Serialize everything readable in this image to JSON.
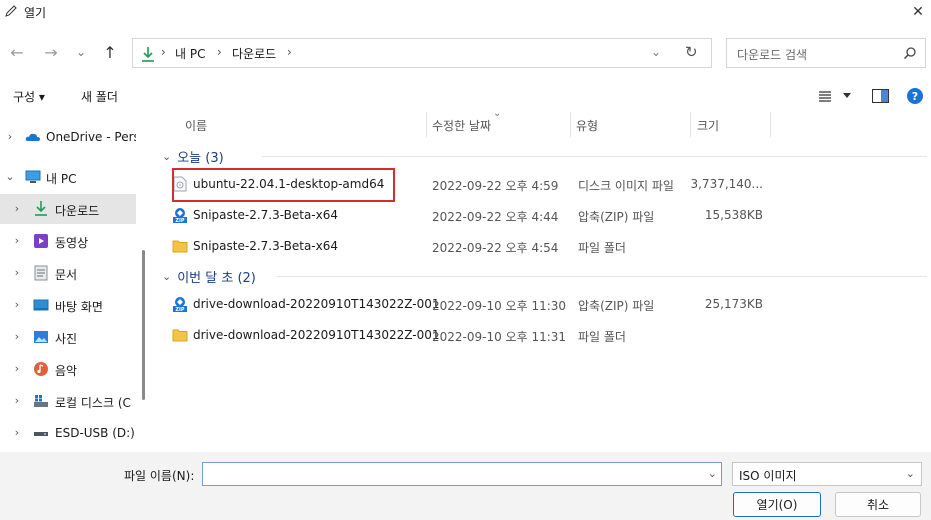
{
  "window": {
    "title": "열기",
    "close_glyph": "✕"
  },
  "nav": {
    "back_glyph": "←",
    "forward_glyph": "→",
    "recent_glyph": "⌄",
    "up_glyph": "↑",
    "refresh_glyph": "↻",
    "dropdown_glyph": "⌄"
  },
  "address": {
    "separator": "›",
    "crumbs": [
      "내 PC",
      "다운로드"
    ]
  },
  "search": {
    "placeholder": "다운로드 검색"
  },
  "toolbar": {
    "organize_label": "구성 ▾",
    "new_folder_label": "새 폴더"
  },
  "sidebar": {
    "items": [
      {
        "label": "OneDrive - Perso",
        "icon": "onedrive-cloud-icon",
        "expand": "›"
      },
      {
        "label": "내 PC",
        "icon": "pc-monitor-icon",
        "expand": "⌄"
      },
      {
        "label": "다운로드",
        "icon": "download-arrow-icon",
        "expand": "›"
      },
      {
        "label": "동영상",
        "icon": "video-icon",
        "expand": "›"
      },
      {
        "label": "문서",
        "icon": "document-icon",
        "expand": "›"
      },
      {
        "label": "바탕 화면",
        "icon": "desktop-icon",
        "expand": "›"
      },
      {
        "label": "사진",
        "icon": "pictures-icon",
        "expand": "›"
      },
      {
        "label": "음악",
        "icon": "music-icon",
        "expand": "›"
      },
      {
        "label": "로컬 디스크 (C",
        "icon": "local-disk-icon",
        "expand": "›"
      },
      {
        "label": "ESD-USB (D:)",
        "icon": "usb-drive-icon",
        "expand": "›"
      }
    ]
  },
  "columns": [
    "이름",
    "수정한 날짜",
    "유형",
    "크기"
  ],
  "groups": [
    {
      "title": "오늘 (3)",
      "files": [
        {
          "name": "ubuntu-22.04.1-desktop-amd64",
          "date": "2022-09-22 오후 4:59",
          "type": "디스크 이미지 파일",
          "size": "3,737,140...",
          "icon": "disc-image-file-icon"
        },
        {
          "name": "Snipaste-2.7.3-Beta-x64",
          "date": "2022-09-22 오후 4:44",
          "type": "압축(ZIP) 파일",
          "size": "15,538KB",
          "icon": "zip-archive-icon"
        },
        {
          "name": "Snipaste-2.7.3-Beta-x64",
          "date": "2022-09-22 오후 4:54",
          "type": "파일 폴더",
          "size": "",
          "icon": "folder-icon"
        }
      ]
    },
    {
      "title": "이번 달 초 (2)",
      "files": [
        {
          "name": "drive-download-20220910T143022Z-001",
          "date": "2022-09-10 오후 11:30",
          "type": "압축(ZIP) 파일",
          "size": "25,173KB",
          "icon": "zip-archive-icon"
        },
        {
          "name": "drive-download-20220910T143022Z-001",
          "date": "2022-09-10 오후 11:31",
          "type": "파일 폴더",
          "size": "",
          "icon": "folder-icon"
        }
      ]
    }
  ],
  "bottom": {
    "filename_label": "파일 이름(N):",
    "filename_value": "",
    "filetype_value": "ISO 이미지",
    "open_label": "열기(O)",
    "cancel_label": "취소"
  },
  "colors": {
    "accent": "#0f6cbd",
    "group_title": "#1f3c88",
    "highlight": "#d32f2f",
    "folder": "#f4c542"
  }
}
